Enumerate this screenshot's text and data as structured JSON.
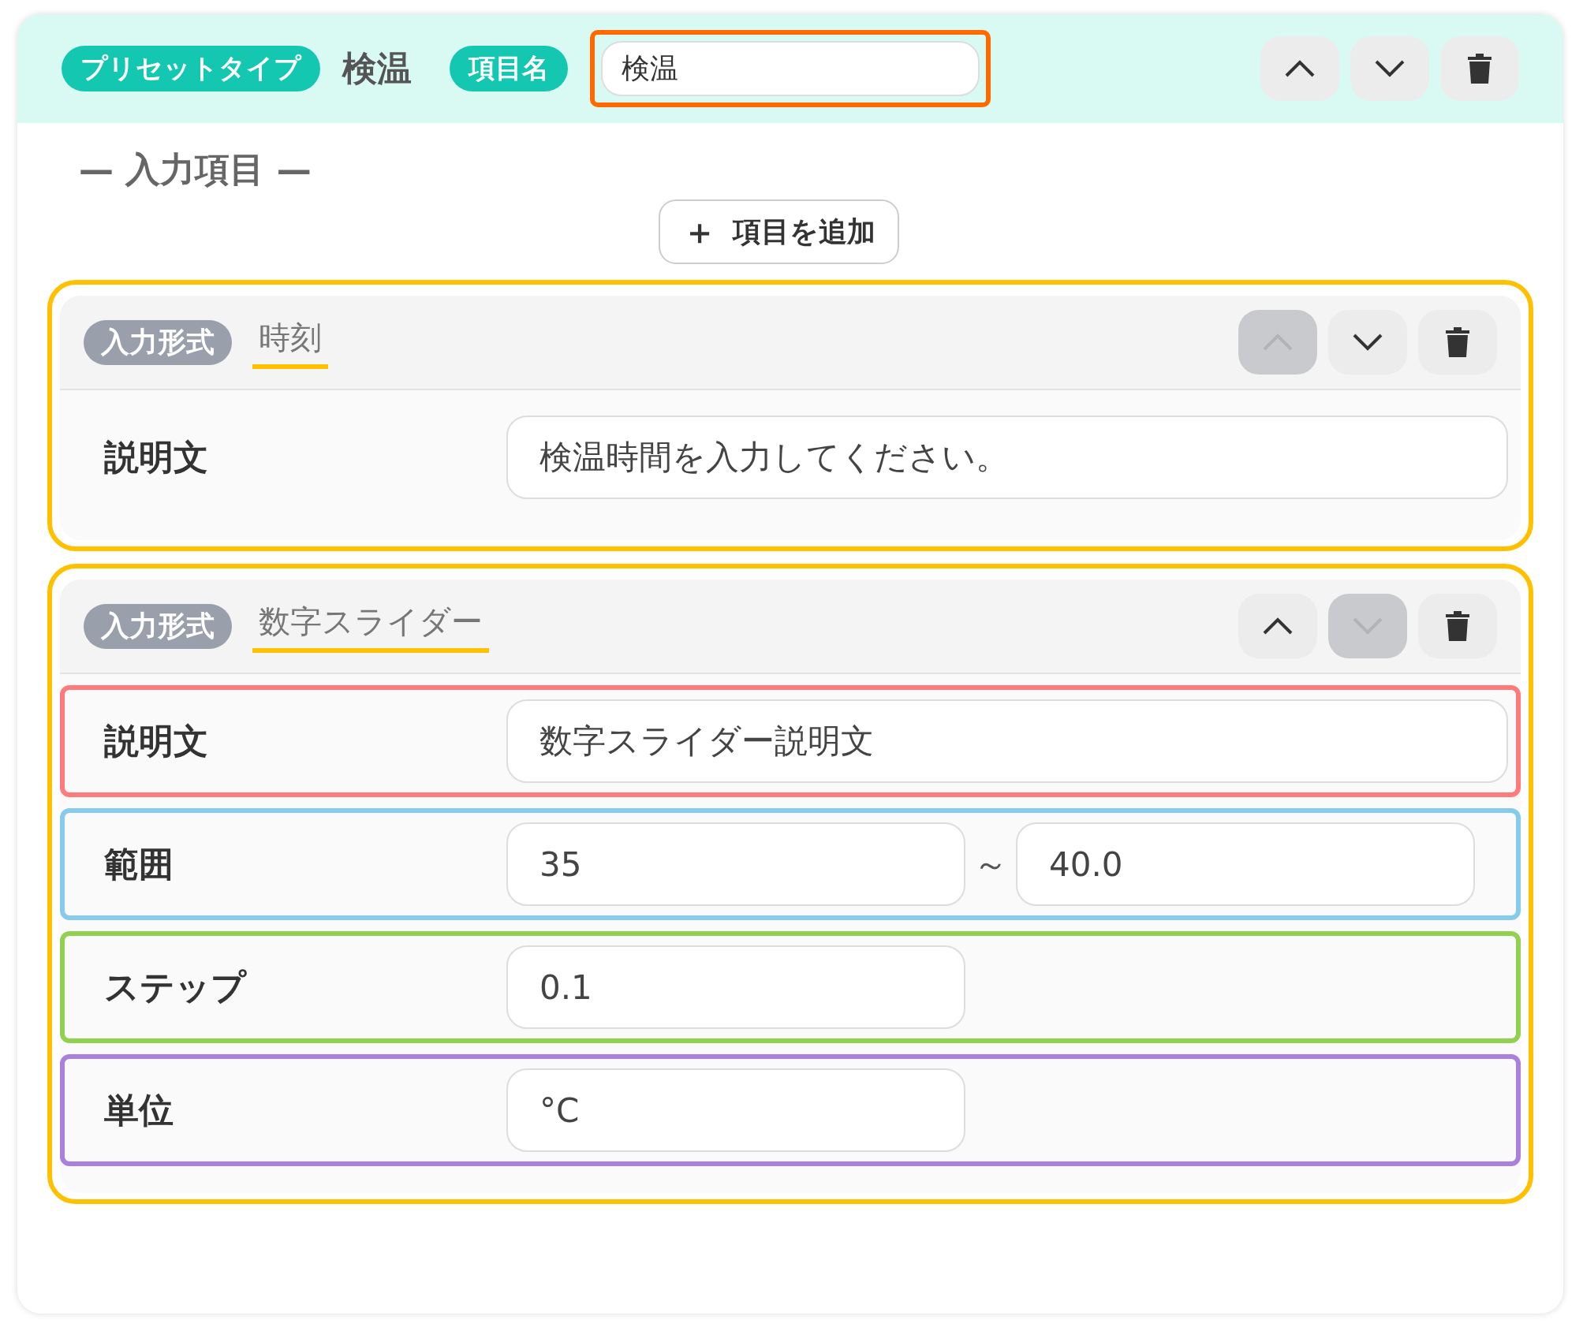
{
  "header": {
    "preset_badge": "プリセットタイプ",
    "preset_value": "検温",
    "name_badge": "項目名",
    "name_field": {
      "value": "検温",
      "color": "#ff6a00"
    },
    "buttons": [
      {
        "kind": "up",
        "disabled": false
      },
      {
        "kind": "down",
        "disabled": false
      },
      {
        "kind": "delete",
        "disabled": false
      }
    ]
  },
  "section_title": "— 入力項目 —",
  "add_button": {
    "icon": "＋",
    "label": "項目を追加"
  },
  "items": [
    {
      "badge": "入力形式",
      "type": "時刻",
      "color": "#ffc000",
      "buttons": [
        {
          "kind": "up",
          "disabled": true
        },
        {
          "kind": "down",
          "disabled": false
        },
        {
          "kind": "delete",
          "disabled": false
        }
      ],
      "rows": [
        {
          "kind": "text",
          "label": "説明文",
          "value": "検温時間を入力してください。"
        }
      ]
    },
    {
      "badge": "入力形式",
      "type": "数字スライダー",
      "color": "#ffc000",
      "buttons": [
        {
          "kind": "up",
          "disabled": false
        },
        {
          "kind": "down",
          "disabled": true
        },
        {
          "kind": "delete",
          "disabled": false
        }
      ],
      "rows": [
        {
          "kind": "text",
          "label": "説明文",
          "value": "数字スライダー説明文",
          "color": "#ff7b7b"
        },
        {
          "kind": "range",
          "label": "範囲",
          "value": "35",
          "separator": "～",
          "value_2": "40.0",
          "color": "#86cbea"
        },
        {
          "kind": "short",
          "label": "ステップ",
          "value": "0.1",
          "color": "#92d050"
        },
        {
          "kind": "short",
          "label": "単位",
          "value": "°C",
          "color": "#aa80dc"
        }
      ]
    }
  ]
}
